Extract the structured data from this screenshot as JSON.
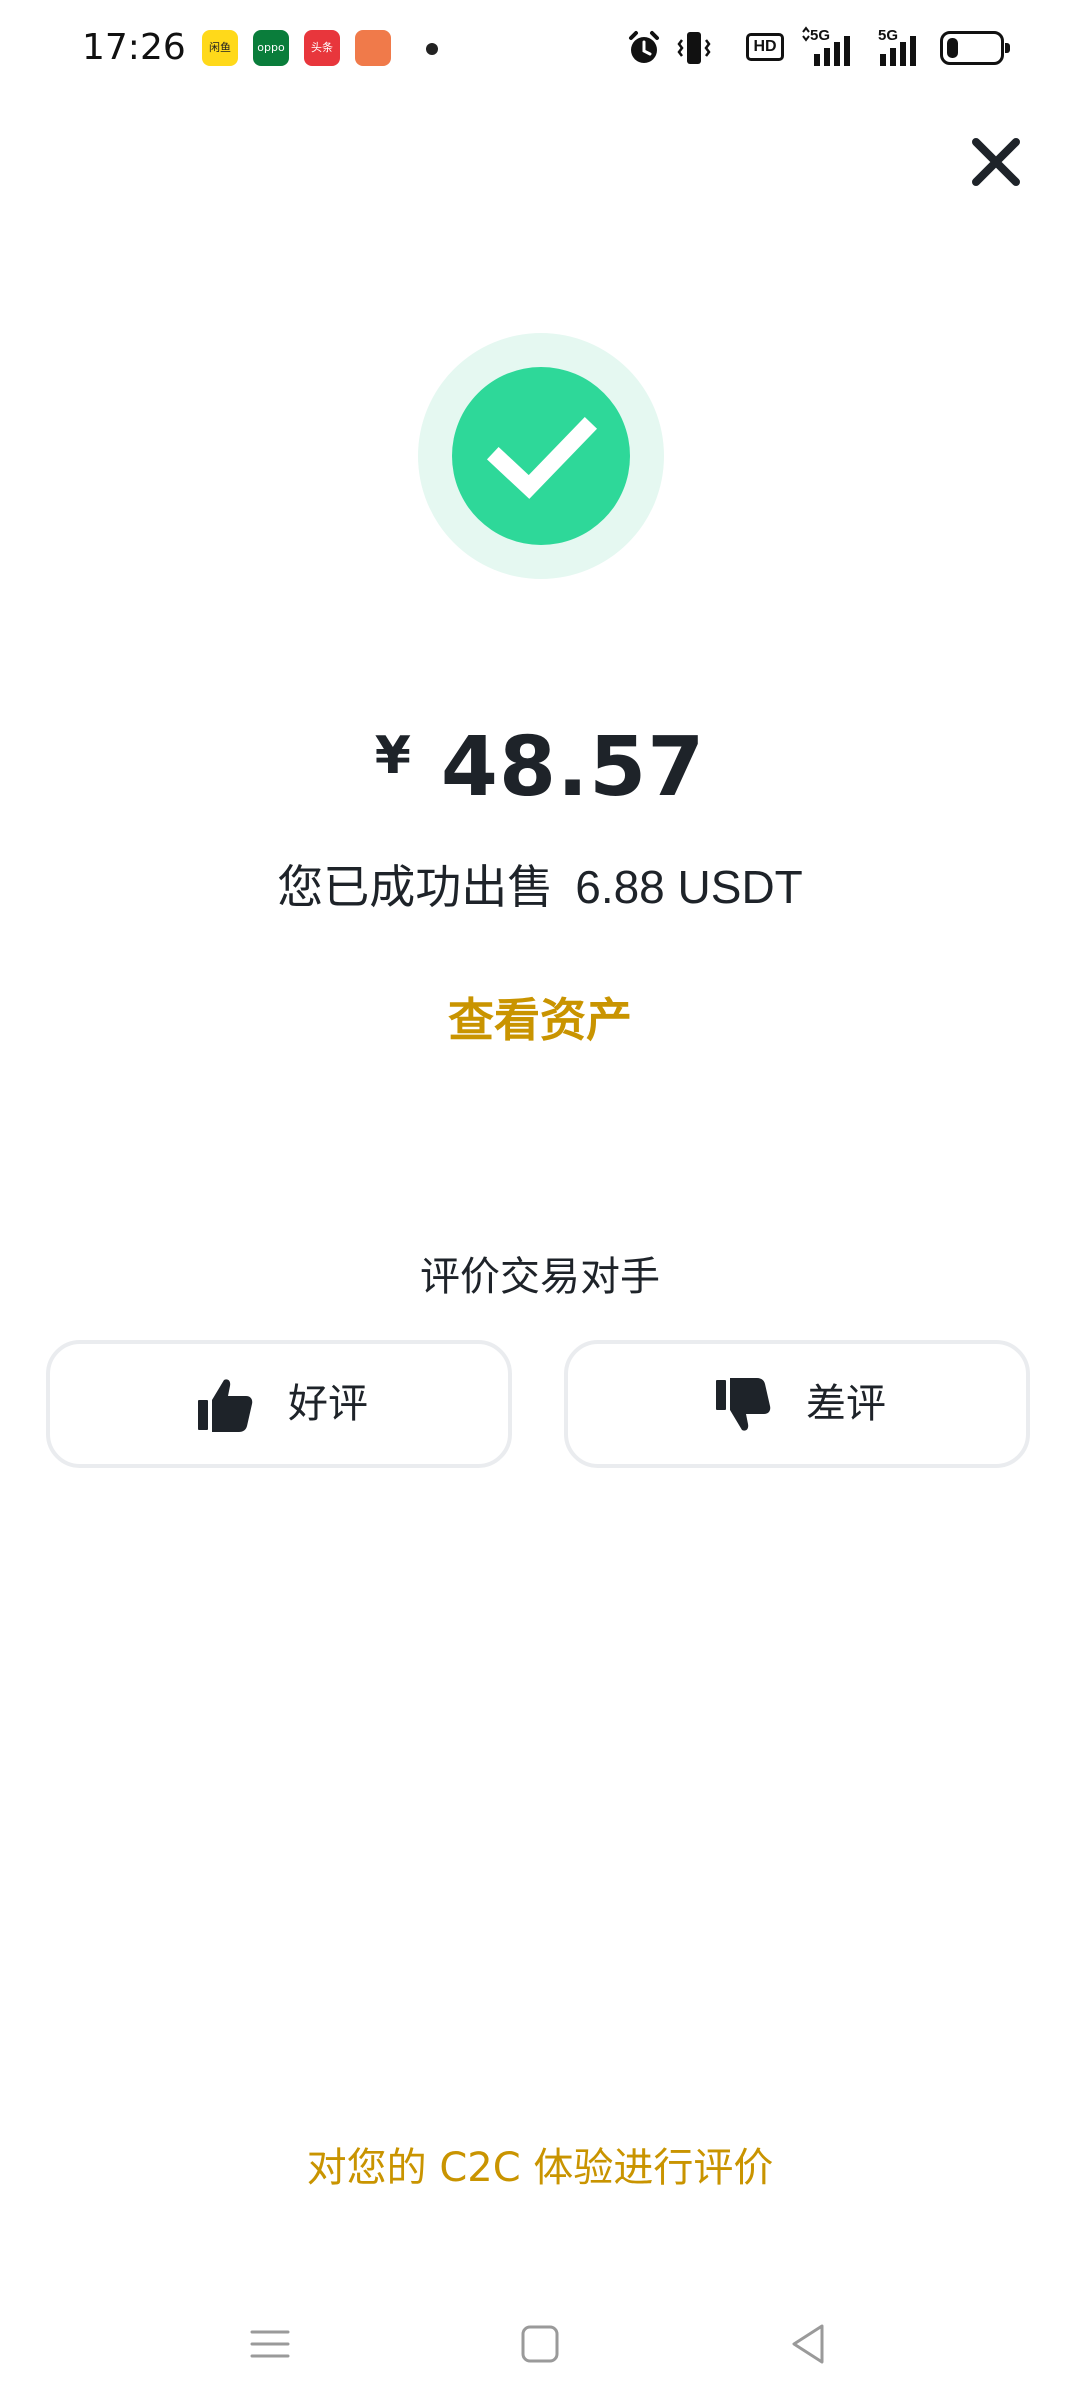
{
  "status_bar": {
    "time": "17:26",
    "apps": [
      {
        "name": "闲鱼",
        "color": "#ffd91a",
        "icon": "xianyu-app-icon"
      },
      {
        "name": "oppo",
        "color": "#0a7d3b",
        "icon": "oppo-app-icon"
      },
      {
        "name": "头条",
        "color": "#e8363c",
        "icon": "toutiao-app-icon"
      },
      {
        "name": "",
        "color": "#f07a4a",
        "icon": "game-app-icon"
      }
    ],
    "hd_label": "HD",
    "signal_label_1": "5G",
    "signal_label_2": "5G",
    "battery_level": 0.22
  },
  "close": {
    "icon": "close-icon"
  },
  "result": {
    "status_icon": "check-icon",
    "currency_symbol": "¥",
    "amount": "48.57",
    "sold_prefix": "您已成功出售",
    "sold_quantity": "6.88 USDT",
    "view_assets_label": "查看资产"
  },
  "rating": {
    "title": "评价交易对手",
    "good_label": "好评",
    "bad_label": "差评"
  },
  "footer": {
    "c2c_feedback_label": "对您的 C2C 体验进行评价"
  },
  "colors": {
    "accent": "#c99400",
    "success": "#2ed899",
    "success_halo": "#e5f8f1",
    "text": "#1e2329",
    "border": "#eaecef"
  }
}
